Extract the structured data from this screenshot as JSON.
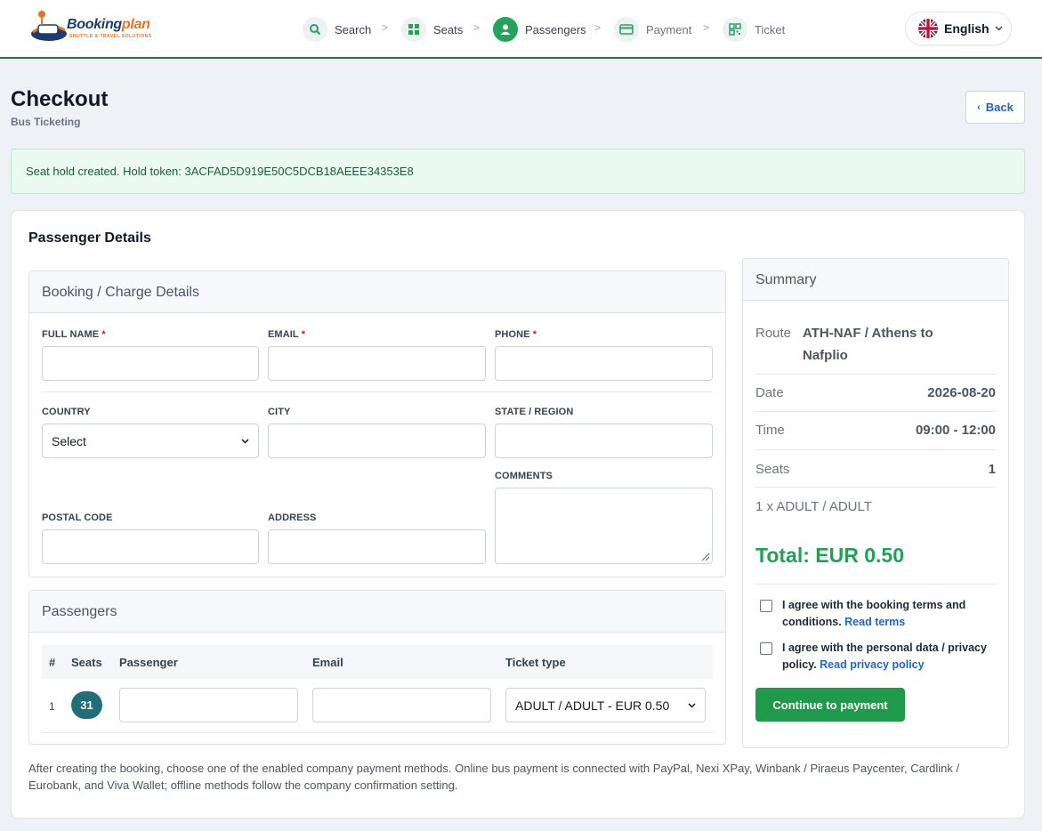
{
  "brand": {
    "name_a": "Booking",
    "name_b": "plan",
    "tagline": "SHUTTLE & TRAVEL SOLUTIONS"
  },
  "steps": [
    {
      "label": "Search",
      "icon": "search-icon"
    },
    {
      "label": "Seats",
      "icon": "grid-icon"
    },
    {
      "label": "Passengers",
      "icon": "user-icon"
    },
    {
      "label": "Payment",
      "icon": "card-icon"
    },
    {
      "label": "Ticket",
      "icon": "qr-icon"
    }
  ],
  "step_separator": ">",
  "language": {
    "label": "English",
    "flag": "uk-flag-icon"
  },
  "page": {
    "title": "Checkout",
    "subtitle": "Bus Ticketing",
    "back": "Back"
  },
  "alert": "Seat hold created. Hold token: 3ACFAD5D919E50C5DCB18AEEE34353E8",
  "card_title": "Passenger Details",
  "booking": {
    "heading": "Booking / Charge Details",
    "full_name": "FULL NAME",
    "email": "EMAIL",
    "phone": "PHONE",
    "required_mark": "*",
    "country": "COUNTRY",
    "country_value": "Select",
    "city": "CITY",
    "state": "STATE / REGION",
    "comments": "COMMENTS",
    "postal": "POSTAL CODE",
    "address": "ADDRESS"
  },
  "passengers": {
    "heading": "Passengers",
    "columns": [
      "#",
      "Seats",
      "Passenger",
      "Email",
      "Ticket type"
    ],
    "rows": [
      {
        "index": "1",
        "seat": "31",
        "ticket_type": "ADULT / ADULT - EUR 0.50"
      }
    ]
  },
  "note": "After creating the booking, choose one of the enabled company payment methods. Online bus payment is connected with PayPal, Nexi XPay, Winbank / Piraeus Paycenter, Cardlink / Eurobank, and Viva Wallet; offline methods follow the company confirmation setting.",
  "summary": {
    "heading": "Summary",
    "route_label": "Route",
    "route_value": "ATH-NAF / Athens to Nafplio",
    "date_label": "Date",
    "date_value": "2026-08-20",
    "time_label": "Time",
    "time_value": "09:00 - 12:00",
    "seats_label": "Seats",
    "seats_value": "1",
    "line_item": "1 x ADULT / ADULT",
    "total": "Total: EUR 0.50",
    "terms_text": "I agree with the booking terms and conditions.",
    "terms_link": "Read terms",
    "privacy_text": "I agree with the personal data / privacy policy.",
    "privacy_link": "Read privacy policy",
    "continue": "Continue to payment"
  },
  "colors": {
    "accent_green": "#22a55b",
    "link_blue": "#2563c9",
    "seat_teal": "#1f6e7a"
  }
}
